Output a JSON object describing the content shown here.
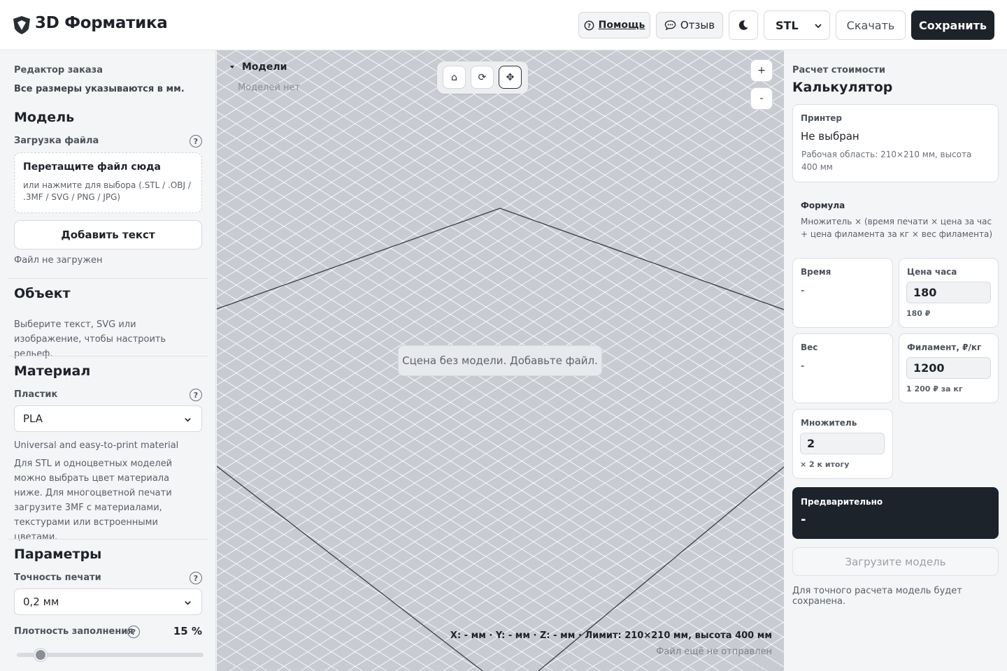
{
  "header": {
    "brand": "3D Форматика",
    "help_label": "Помощь",
    "feedback_label": "Отзыв",
    "format_value": "STL",
    "download_label": "Скачать",
    "save_label": "Сохранить"
  },
  "left": {
    "editor_caption": "Редактор заказа",
    "units_note": "Все размеры указываются в мм.",
    "model": {
      "title": "Модель",
      "upload_label": "Загрузка файла",
      "help": "?",
      "dropzone_title": "Перетащите файл сюда",
      "dropzone_hint": "или нажмите для выбора (.STL / .OBJ / .3MF / SVG / PNG / JPG)",
      "add_text_label": "Добавить текст",
      "file_status": "Файл не загружен"
    },
    "object": {
      "title": "Объект",
      "hint": "Выберите текст, SVG или изображение, чтобы настроить рельеф."
    },
    "material": {
      "title": "Материал",
      "plastic_label": "Пластик",
      "help": "?",
      "plastic_value": "PLA",
      "plastic_desc": "Universal and easy-to-print material",
      "color_note": "Для STL и одноцветных моделей можно выбрать цвет материала ниже. Для многоцветной печати загрузите 3MF с материалами, текстурами или встроенными цветами."
    },
    "params": {
      "title": "Параметры",
      "precision_label": "Точность печати",
      "help": "?",
      "precision_value": "0,2 мм",
      "infill_label": "Плотность заполнения",
      "infill_help": "?",
      "infill_value": "15 %",
      "infill_fraction": 0.15
    }
  },
  "viewport": {
    "models_title": "Модели",
    "models_empty": "Моделей нет",
    "tools": {
      "home": "⌂",
      "rotate": "⟳",
      "move": "✥"
    },
    "zoom_in": "+",
    "zoom_out": "-",
    "empty_message": "Сцена без модели. Добавьте файл.",
    "coords": "X: - мм · Y: - мм · Z: - мм · Лимит: 210×210 мм, высота 400 мм",
    "send_status": "Файл ещё не отправлен"
  },
  "right": {
    "caption": "Расчет стоимости",
    "title": "Калькулятор",
    "printer": {
      "label": "Принтер",
      "value": "Не выбран",
      "area": "Рабочая область: 210×210 мм, высота 400 мм"
    },
    "formula": {
      "label": "Формула",
      "text": "Множитель × (время печати × цена за час + цена филамента за кг × вес филамента)"
    },
    "time": {
      "label": "Время",
      "value": "-"
    },
    "hour_price": {
      "label": "Цена часа",
      "value": "180",
      "note": "180 ₽"
    },
    "weight": {
      "label": "Вес",
      "value": "-"
    },
    "filament": {
      "label": "Филамент, ₽/кг",
      "value": "1200",
      "note": "1 200 ₽ за кг"
    },
    "multiplier": {
      "label": "Множитель",
      "value": "2",
      "note": "× 2 к итогу"
    },
    "preview": {
      "label": "Предварительно",
      "value": "-"
    },
    "upload_button": "Загрузите модель",
    "footnote": "Для точного расчета модель будет сохранена."
  },
  "colors": {
    "dark": "#1d232b",
    "viewport_bg": "#c8cbd1",
    "panel_bg": "#f4f5f7"
  }
}
